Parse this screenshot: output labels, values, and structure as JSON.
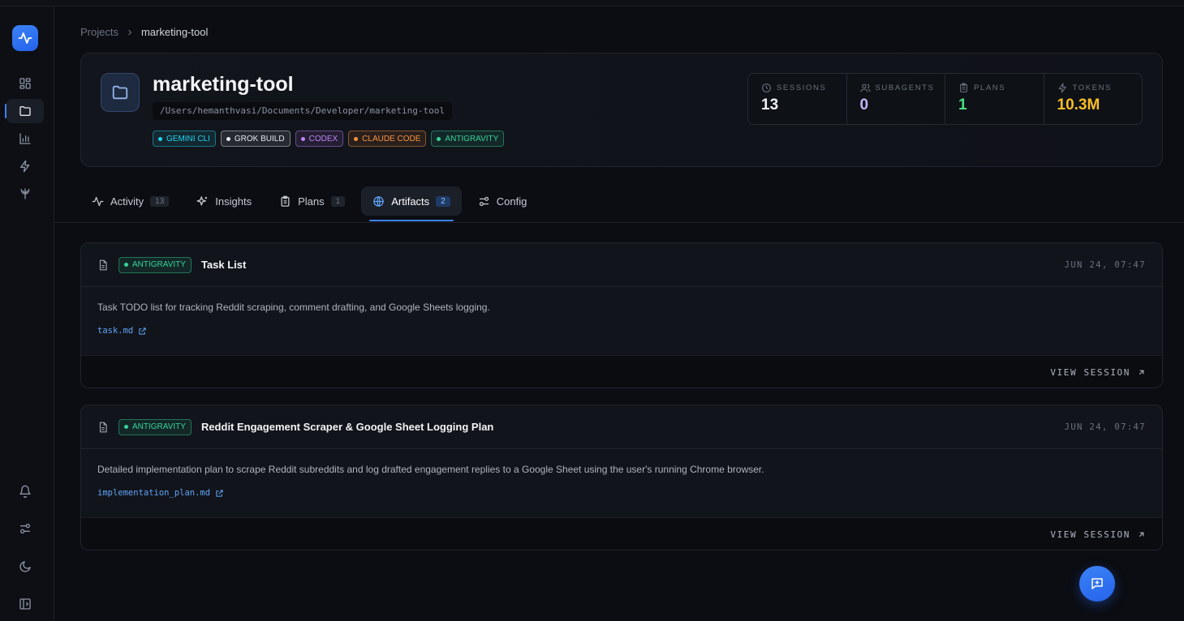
{
  "breadcrumb": {
    "root": "Projects",
    "current": "marketing-tool"
  },
  "project": {
    "name": "marketing-tool",
    "path": "/Users/hemanthvasi/Documents/Developer/marketing-tool",
    "tags": [
      {
        "label": "GEMINI CLI",
        "color": "#22d3ee"
      },
      {
        "label": "GROK BUILD",
        "color": "#e5e7eb"
      },
      {
        "label": "CODEX",
        "color": "#c084fc"
      },
      {
        "label": "CLAUDE CODE",
        "color": "#fb923c"
      },
      {
        "label": "ANTIGRAVITY",
        "color": "#34d399"
      }
    ]
  },
  "stats": [
    {
      "label": "SESSIONS",
      "value": "13",
      "color": "#f3f4f6",
      "icon": "clock-icon"
    },
    {
      "label": "SUBAGENTS",
      "value": "0",
      "color": "#c4b5fd",
      "icon": "users-icon"
    },
    {
      "label": "PLANS",
      "value": "1",
      "color": "#4ade80",
      "icon": "clipboard-icon"
    },
    {
      "label": "TOKENS",
      "value": "10.3M",
      "color": "#fbbf24",
      "icon": "bolt-icon"
    }
  ],
  "tabs": [
    {
      "label": "Activity",
      "count": "13",
      "icon": "activity-icon"
    },
    {
      "label": "Insights",
      "count": "",
      "icon": "sparkles-icon"
    },
    {
      "label": "Plans",
      "count": "1",
      "icon": "clipboard-icon"
    },
    {
      "label": "Artifacts",
      "count": "2",
      "icon": "globe-icon",
      "active": true
    },
    {
      "label": "Config",
      "count": "",
      "icon": "sliders-icon"
    }
  ],
  "artifacts": [
    {
      "tag": "ANTIGRAVITY",
      "title": "Task List",
      "date": "JUN 24, 07:47",
      "description": "Task TODO list for tracking Reddit scraping, comment drafting, and Google Sheets logging.",
      "file": "task.md",
      "action": "VIEW SESSION"
    },
    {
      "tag": "ANTIGRAVITY",
      "title": "Reddit Engagement Scraper & Google Sheet Logging Plan",
      "date": "JUN 24, 07:47",
      "description": "Detailed implementation plan to scrape Reddit subreddits and log drafted engagement replies to a Google Sheet using the user's running Chrome browser.",
      "file": "implementation_plan.md",
      "action": "VIEW SESSION"
    }
  ],
  "colors": {
    "accent": "#3b82f6",
    "antigravity": "#34d399"
  }
}
